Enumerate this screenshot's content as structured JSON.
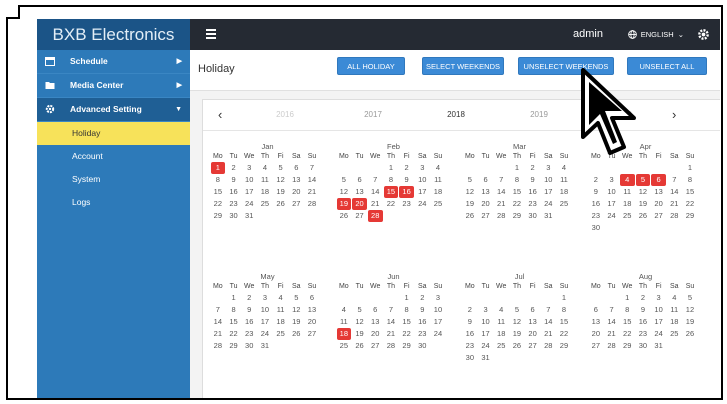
{
  "brand": "BXB Electronics",
  "topbar": {
    "user": "admin",
    "language": "ENGLISH"
  },
  "sidebar": {
    "items": [
      {
        "label": "Schedule"
      },
      {
        "label": "Media Center"
      },
      {
        "label": "Advanced Setting"
      }
    ],
    "subitems": [
      {
        "label": "Holiday"
      },
      {
        "label": "Account"
      },
      {
        "label": "System"
      },
      {
        "label": "Logs"
      }
    ]
  },
  "page": {
    "title": "Holiday",
    "buttons": {
      "all_holiday": "ALL HOLIDAY",
      "select_weekends": "SELECT WEEKENDS",
      "unselect_weekends": "UNSELECT WEEKENDS",
      "unselect_all": "UNSELECT ALL"
    }
  },
  "years": [
    "2016",
    "2017",
    "2018",
    "2019",
    "2020"
  ],
  "selected_year": "2018",
  "weekday_headers": [
    "Mo",
    "Tu",
    "We",
    "Th",
    "Fi",
    "Sa",
    "Su"
  ],
  "months": [
    {
      "name": "Jan",
      "start": 0,
      "days": 31,
      "holidays": [
        1
      ]
    },
    {
      "name": "Feb",
      "start": 3,
      "days": 28,
      "holidays": [
        15,
        16,
        19,
        20,
        28
      ]
    },
    {
      "name": "Mar",
      "start": 3,
      "days": 31,
      "holidays": []
    },
    {
      "name": "Apr",
      "start": 6,
      "days": 30,
      "holidays": [
        4,
        5,
        6
      ]
    },
    {
      "name": "May",
      "start": 1,
      "days": 31,
      "holidays": []
    },
    {
      "name": "Jun",
      "start": 4,
      "days": 30,
      "holidays": [
        18
      ]
    },
    {
      "name": "Jul",
      "start": 6,
      "days": 31,
      "holidays": []
    },
    {
      "name": "Aug",
      "start": 2,
      "days": 31,
      "holidays": []
    }
  ],
  "icons": {
    "schedule": "calendar-icon",
    "media": "folder-icon",
    "advanced": "gear-icon",
    "language": "globe-icon"
  },
  "colors": {
    "sidebar": "#2d7ab9",
    "topbar": "#252a33",
    "active_sub": "#f7e25a",
    "holiday": "#e53935",
    "button": "#3b8ad6"
  }
}
